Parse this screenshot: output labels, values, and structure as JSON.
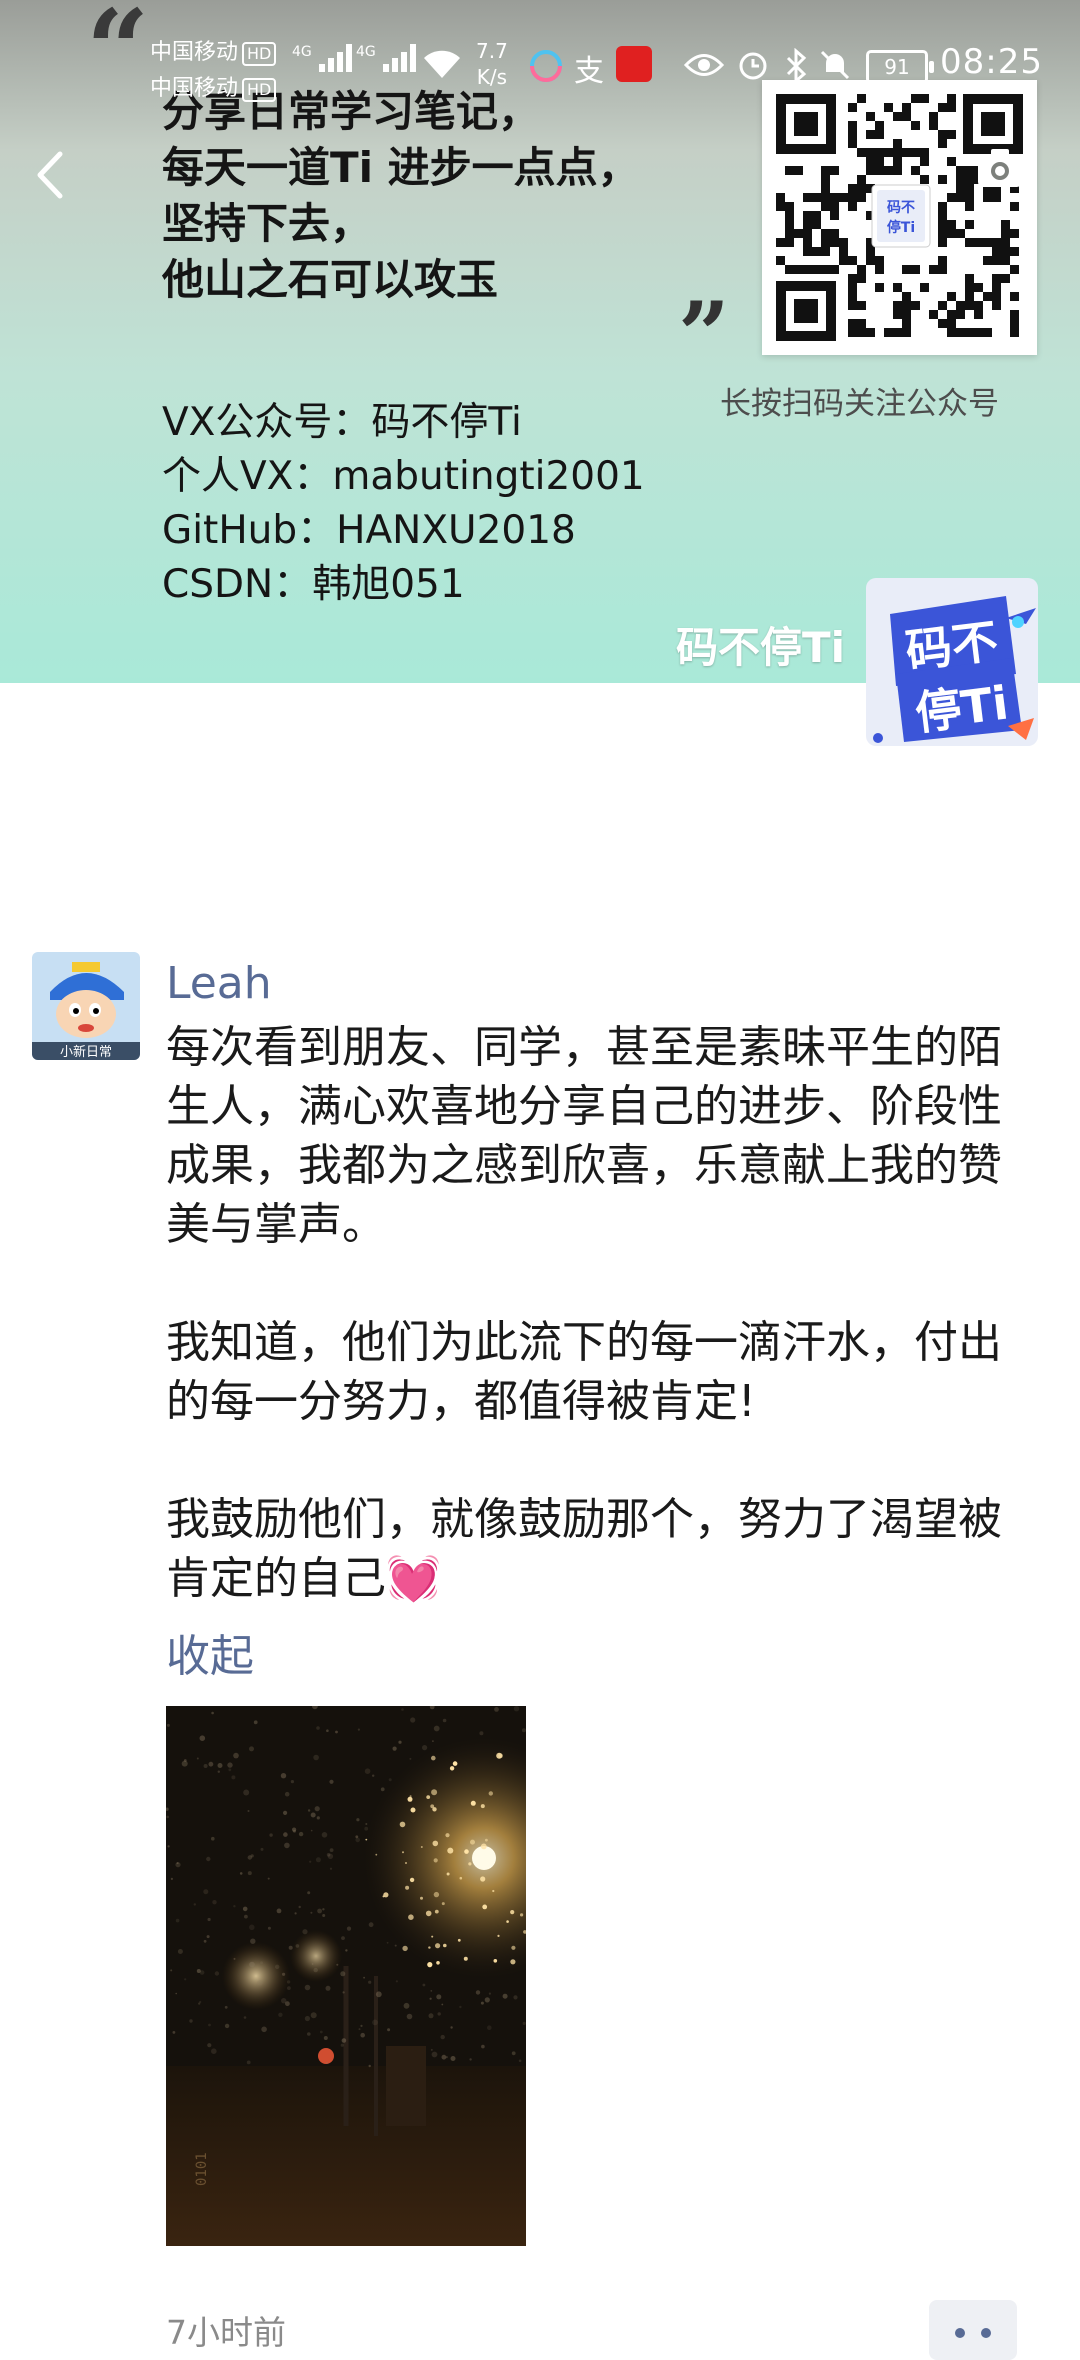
{
  "status_bar": {
    "carrier_1": "中国移动",
    "carrier_2": "中国移动",
    "hd_label": "HD",
    "network_type": "4G",
    "net_speed_value": "7.7",
    "net_speed_unit": "K/s",
    "battery_level": "91",
    "time": "08:25",
    "icons": [
      "browser-swirl-icon",
      "app-zhi-icon",
      "weibo-icon",
      "eye-icon",
      "alarm-icon",
      "bluetooth-icon",
      "mute-icon"
    ]
  },
  "cover": {
    "lines": [
      "分享日常学习笔记，",
      "每天一道Ti 进步一点点，",
      "坚持下去，",
      "他山之石可以攻玉"
    ],
    "contact": [
      "VX公众号：码不停Ti",
      "个人VX：mabutingti2001",
      "GitHub：HANXU2018",
      "CSDN：韩旭051"
    ],
    "qr_caption": "长按扫码关注公众号",
    "watermark": "码不停Ti",
    "logo_line1": "码不",
    "logo_line2": "停Ti",
    "colors": {
      "gradient_top": "#9a9d98",
      "gradient_bottom": "#a9e9d8",
      "logo_blue": "#3b55d8"
    }
  },
  "post": {
    "author": "Leah",
    "avatar_caption": "小新日常",
    "paragraphs": [
      "每次看到朋友、同学，甚至是素昧平生的陌生人，满心欢喜地分享自己的进步、阶段性成果，我都为之感到欣喜，乐意献上我的赞美与掌声。",
      "我知道，他们为此流下的每一滴汗水，付出的每一分努力，都值得被肯定!",
      "我鼓励他们，就像鼓励那个，努力了渴望被肯定的自己"
    ],
    "emoji": "💓",
    "collapse_label": "收起",
    "photo_text": "0101",
    "time": "7小时前",
    "colors": {
      "link": "#586b95"
    }
  }
}
